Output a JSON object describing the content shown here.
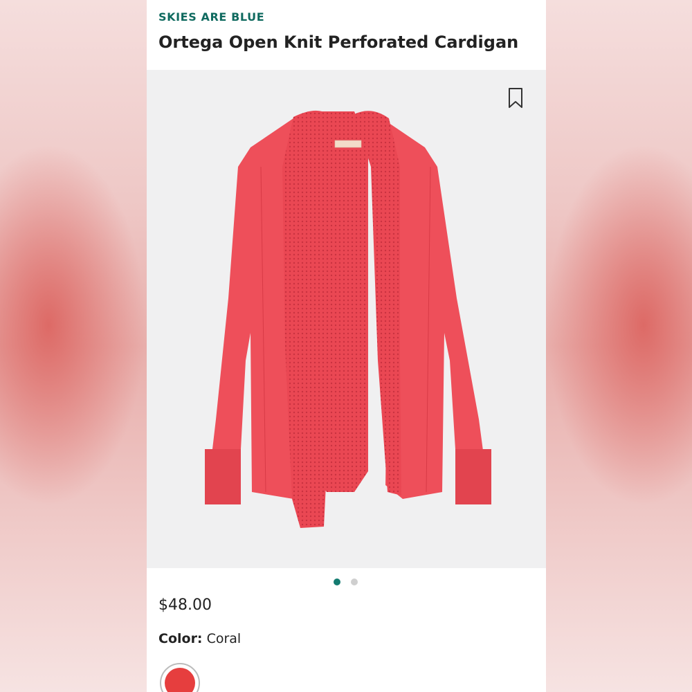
{
  "product": {
    "brand": "SKIES ARE BLUE",
    "title": "Ortega Open Knit Perforated Cardigan",
    "price": "$48.00",
    "color_label": "Color:",
    "color_value": "Coral"
  },
  "carousel": {
    "total_images": 2,
    "active_index": 1
  },
  "icons": {
    "bookmark": "bookmark-icon",
    "swatch": "coral-color-swatch"
  },
  "colors": {
    "brand_text": "#0f6a5f",
    "active_dot": "#137b70",
    "garment": "#ee4f5a",
    "swatch": "#e63e3e"
  }
}
